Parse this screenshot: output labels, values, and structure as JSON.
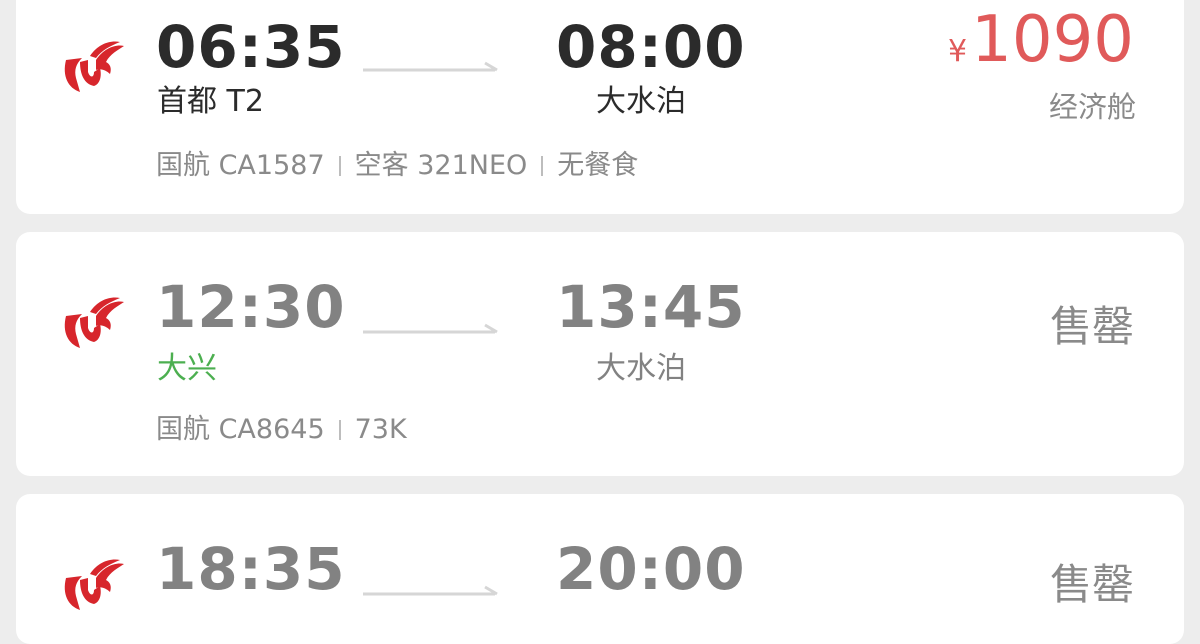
{
  "colors": {
    "price_red": "#e05a5a",
    "logo_red": "#d7262c",
    "green_airport": "#4caf50",
    "gray_text": "#8a8a8a"
  },
  "flights": [
    {
      "logo_icon": "air-china-logo-icon",
      "dep_time": "06:35",
      "dep_airport": "首都 T2",
      "arr_time": "08:00",
      "arr_airport": "大水泊",
      "info": [
        "国航 CA1587",
        "空客 321NEO",
        "无餐食"
      ],
      "currency": "¥",
      "price": "1090",
      "cabin": "经济舱",
      "status": ""
    },
    {
      "logo_icon": "air-china-logo-icon",
      "dep_time": "12:30",
      "dep_airport": "大兴",
      "arr_time": "13:45",
      "arr_airport": "大水泊",
      "info": [
        "国航 CA8645",
        "73K"
      ],
      "status": "售罄"
    },
    {
      "logo_icon": "air-china-logo-icon",
      "dep_time": "18:35",
      "arr_time": "20:00",
      "status": "售罄"
    }
  ]
}
